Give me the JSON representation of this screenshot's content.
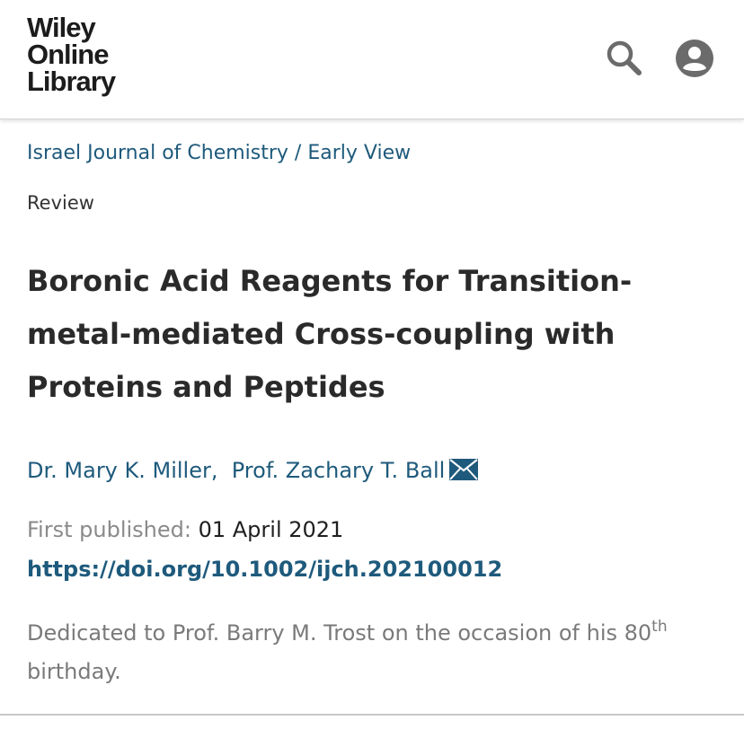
{
  "header": {
    "logo_line1": "Wiley",
    "logo_line2": "Online",
    "logo_line3": "Library",
    "search_icon": "search-icon",
    "account_icon": "account-icon"
  },
  "breadcrumb": {
    "journal": "Israel Journal of Chemistry",
    "separator": " / ",
    "section": "Early View"
  },
  "article": {
    "type": "Review",
    "title": "Boronic Acid Reagents for Transition-metal-mediated Cross-coupling with Proteins and Peptides",
    "authors": [
      {
        "name": "Dr. Mary K. Miller,"
      },
      {
        "name": "Prof. Zachary T. Ball"
      }
    ],
    "published_label": "First published:",
    "published_date": "01 April 2021",
    "doi": "https://doi.org/10.1002/ijch.202100012",
    "dedication_text": "Dedicated to Prof. Barry M. Trost on the occasion of his 80",
    "dedication_sup": "th",
    "dedication_end": "birthday."
  },
  "colors": {
    "link": "#1e5a7c",
    "text": "#2a2a2a",
    "muted": "#8a8a8a"
  }
}
